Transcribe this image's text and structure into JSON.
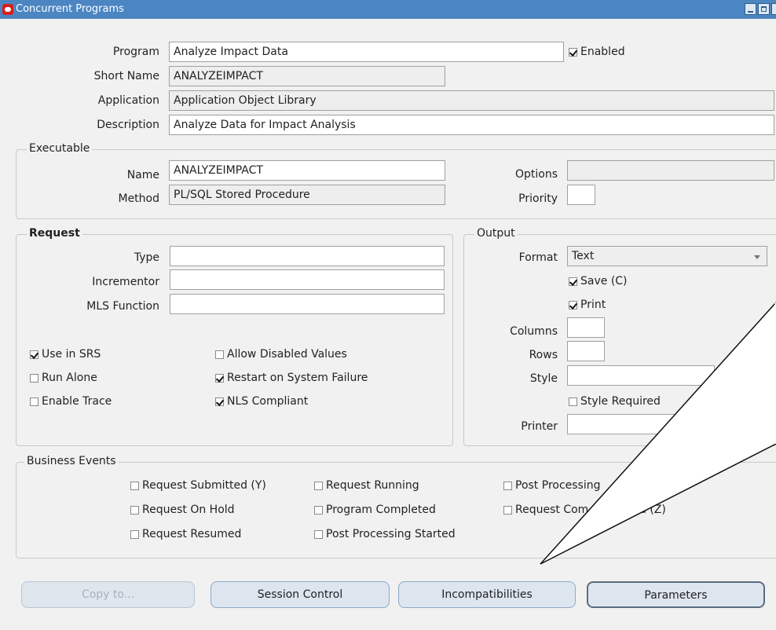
{
  "window": {
    "title": "Concurrent Programs"
  },
  "main": {
    "program": {
      "label": "Program",
      "value": "Analyze Impact Data"
    },
    "enabled": {
      "label": "Enabled",
      "checked": true
    },
    "short_name": {
      "label": "Short Name",
      "value": "ANALYZEIMPACT"
    },
    "application": {
      "label": "Application",
      "value": "Application Object Library"
    },
    "description": {
      "label": "Description",
      "value": "Analyze Data for Impact Analysis"
    }
  },
  "executable": {
    "title": "Executable",
    "name": {
      "label": "Name",
      "value": "ANALYZEIMPACT"
    },
    "method": {
      "label": "Method",
      "value": "PL/SQL Stored Procedure"
    },
    "options": {
      "label": "Options",
      "value": ""
    },
    "priority": {
      "label": "Priority",
      "value": ""
    }
  },
  "request": {
    "title": "Request",
    "type": {
      "label": "Type",
      "value": ""
    },
    "incrementor": {
      "label": "Incrementor",
      "value": ""
    },
    "mls_function": {
      "label": "MLS Function",
      "value": ""
    },
    "checks": {
      "use_in_srs": {
        "label": "Use in SRS",
        "checked": true
      },
      "allow_disabled": {
        "label": "Allow Disabled Values",
        "checked": false
      },
      "run_alone": {
        "label": "Run Alone",
        "checked": false
      },
      "restart": {
        "label": "Restart on System Failure",
        "checked": true
      },
      "enable_trace": {
        "label": "Enable Trace",
        "checked": false
      },
      "nls_compliant": {
        "label": "NLS Compliant",
        "checked": true
      }
    }
  },
  "output": {
    "title": "Output",
    "format": {
      "label": "Format",
      "value": "Text"
    },
    "save": {
      "label": "Save (C)",
      "checked": true
    },
    "print": {
      "label": "Print",
      "checked": true
    },
    "columns": {
      "label": "Columns",
      "value": ""
    },
    "rows": {
      "label": "Rows",
      "value": ""
    },
    "style": {
      "label": "Style",
      "value": ""
    },
    "style_required": {
      "label": "Style Required",
      "checked": false
    },
    "printer": {
      "label": "Printer",
      "value": ""
    }
  },
  "business_events": {
    "title": "Business Events",
    "items": {
      "submitted": "Request Submitted (Y)",
      "running": "Request Running",
      "post_processing": "Post Processing",
      "on_hold": "Request On Hold",
      "program_completed": "Program Completed",
      "request_completed_prefix": "Request Com",
      "request_completed_suffix": "d (Z)",
      "resumed": "Request Resumed",
      "post_processing_started": "Post Processing Started"
    }
  },
  "buttons": {
    "copy_to": "Copy to...",
    "session_control": "Session Control",
    "incompatibilities": "Incompatibilities",
    "parameters": "Parameters"
  },
  "colors": {
    "titlebar": "#4c86c2",
    "background": "#f1f1f1",
    "button_fill": "#dde6ef"
  }
}
